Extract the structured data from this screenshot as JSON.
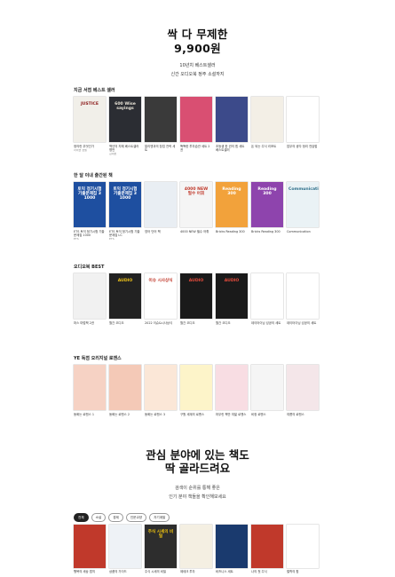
{
  "hero": {
    "title_line1": "싹 다 무제한",
    "title_line2": "9,900원",
    "subtitle1": "10년치 베스트셀러",
    "subtitle2": "신간 오디오북 정주 소설까지"
  },
  "sections": [
    {
      "title": "지금 서점 베스트 셀러",
      "books": [
        {
          "cover_text": "JUSTICE",
          "title": "정의란 무엇인가",
          "author": "마이클 샌델",
          "color": "#f1efe9",
          "text_color": "#8b1a1a"
        },
        {
          "cover_text": "600 Wise sayings",
          "title": "백년의 지혜 베스트셀러 명언",
          "author": "김대호",
          "color": "#2b2d33",
          "text_color": "#e9e4d8"
        },
        {
          "cover_text": "",
          "title": "알리엔과의 창업 전략 세트",
          "author": "",
          "color": "#3a3a3a",
          "text_color": "#fff"
        },
        {
          "cover_text": "",
          "title": "똑똑한 투자습관 세트 2권",
          "author": "",
          "color": "#d94f72",
          "text_color": "#fff"
        },
        {
          "cover_text": "",
          "title": "초등생 한 권의 힘 세트 베스트셀러",
          "author": "",
          "color": "#3c4a8a",
          "text_color": "#fff"
        },
        {
          "cover_text": "",
          "title": "돈 되는 주식 리포트",
          "author": "",
          "color": "#f3efe6",
          "text_color": "#c0392b"
        },
        {
          "cover_text": "",
          "title": "업무의 생각 정리 연습법",
          "author": "",
          "color": "#ffffff",
          "text_color": "#2a8a5a"
        }
      ]
    },
    {
      "title": "한 달 이내 출간된 책",
      "books": [
        {
          "cover_text": "토익 정기시험 기출문제집 3 1000",
          "title": "ETS 토익 정기시험 기출문제집 1000",
          "author": "ETS",
          "color": "#1e4fa0",
          "text_color": "#ffffff"
        },
        {
          "cover_text": "토익 정기시험 기출문제집 3 1000",
          "title": "ETS 토익 정기시험 기출문제집 LC",
          "author": "ETS",
          "color": "#1e4fa0",
          "text_color": "#ffffff"
        },
        {
          "cover_text": "",
          "title": "영어 단어 책",
          "author": "",
          "color": "#e9eef3",
          "text_color": "#333"
        },
        {
          "cover_text": "4000 NEW 필수 어휘",
          "title": "4000 NEW 필수 어휘",
          "author": "",
          "color": "#f5f5f5",
          "text_color": "#c0392b"
        },
        {
          "cover_text": "Reading 300",
          "title": "Bricks Reading 300",
          "author": "",
          "color": "#f2a23b",
          "text_color": "#ffffff"
        },
        {
          "cover_text": "Reading 300",
          "title": "Bricks Reading 300",
          "author": "",
          "color": "#8e44ad",
          "text_color": "#ffffff"
        },
        {
          "cover_text": "Communication",
          "title": "Communication",
          "author": "",
          "color": "#eaf2f5",
          "text_color": "#2c6e8a"
        }
      ]
    },
    {
      "title": "오디오북 BEST",
      "books": [
        {
          "cover_text": "",
          "title": "마스 마법책 2권",
          "author": "",
          "color": "#f1f1f1",
          "text_color": "#333"
        },
        {
          "cover_text": "AUDIO",
          "title": "월간 오디오",
          "author": "",
          "color": "#222222",
          "text_color": "#f0c419"
        },
        {
          "cover_text": "이슈 시사상식",
          "title": "2022 이슈&시사상식",
          "author": "",
          "color": "#ffffff",
          "text_color": "#c0392b"
        },
        {
          "cover_text": "AUDIO",
          "title": "월간 오디오",
          "author": "",
          "color": "#1a1a1a",
          "text_color": "#e74c3c"
        },
        {
          "cover_text": "AUDIO",
          "title": "월간 오디오",
          "author": "",
          "color": "#1a1a1a",
          "text_color": "#e74c3c"
        },
        {
          "cover_text": "",
          "title": "데이터이닝 성공의 세트",
          "author": "",
          "color": "#ffffff",
          "text_color": "#2a9d6a"
        },
        {
          "cover_text": "",
          "title": "데이터이닝 성공의 세트",
          "author": "",
          "color": "#ffffff",
          "text_color": "#2a9d6a"
        }
      ]
    },
    {
      "title": "YE 독점 오리지널 로맨스",
      "books": [
        {
          "cover_text": "",
          "title": "동화는 로맨스 1",
          "author": "",
          "color": "#f6d2c4",
          "text_color": "#333"
        },
        {
          "cover_text": "",
          "title": "동화는 로맨스 2",
          "author": "",
          "color": "#f4c9b7",
          "text_color": "#333"
        },
        {
          "cover_text": "",
          "title": "동화는 로맨스 3",
          "author": "",
          "color": "#fbe7d7",
          "text_color": "#333"
        },
        {
          "cover_text": "",
          "title": "구원 세계의 로맨스",
          "author": "",
          "color": "#fdf4c9",
          "text_color": "#333"
        },
        {
          "cover_text": "",
          "title": "마무린 책만 여덟 로맨스",
          "author": "",
          "color": "#f8dde3",
          "text_color": "#333"
        },
        {
          "cover_text": "",
          "title": "비정 로맨스",
          "author": "",
          "color": "#f5f5f5",
          "text_color": "#333"
        },
        {
          "cover_text": "",
          "title": "여름의 로맨스",
          "author": "",
          "color": "#f4e6e9",
          "text_color": "#333"
        }
      ]
    }
  ],
  "interest": {
    "title_line1": "관심 분야에 있는 책도",
    "title_line2": "딱 골라드려요",
    "subtitle1": "검색이 순위를 통해 좋은",
    "subtitle2": "인기 분야 책들을 확인해보세요"
  },
  "chips": [
    "전체",
    "소설",
    "경제",
    "인문교양",
    "자기계발"
  ],
  "bottom_books": [
    {
      "cover_text": "",
      "title": "행복의 세상 법칙",
      "color": "#c0392b",
      "text_color": "#fff"
    },
    {
      "cover_text": "",
      "title": "상품의 가이드",
      "color": "#eef2f6",
      "text_color": "#1e4fa0"
    },
    {
      "cover_text": "주식 시세의 비밀",
      "title": "주식 시세의 비밀",
      "color": "#2d2d2d",
      "text_color": "#f1c40f"
    },
    {
      "cover_text": "",
      "title": "제테크 투자",
      "color": "#f4efe2",
      "text_color": "#c0392b"
    },
    {
      "cover_text": "",
      "title": "비즈니스 세트",
      "color": "#1a3a6e",
      "text_color": "#fff"
    },
    {
      "cover_text": "",
      "title": "나의 첫 주식",
      "color": "#c0392b",
      "text_color": "#fff"
    },
    {
      "cover_text": "",
      "title": "철학의 힘",
      "color": "#ffffff",
      "text_color": "#333"
    }
  ]
}
